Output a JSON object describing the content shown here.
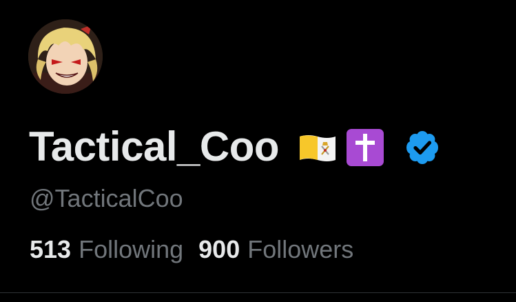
{
  "profile": {
    "display_name": "Tactical_Coo",
    "handle": "@TacticalCoo",
    "badges": [
      "vatican-flag-emoji",
      "latin-cross-emoji",
      "verified-badge-icon"
    ]
  },
  "stats": {
    "following_count": "513",
    "following_label": "Following",
    "followers_count": "900",
    "followers_label": "Followers"
  },
  "colors": {
    "background": "#000000",
    "primary_text": "#e7e9ea",
    "secondary_text": "#71767b",
    "verified_blue": "#1d9bf0",
    "cross_purple": "#a84ad3"
  }
}
